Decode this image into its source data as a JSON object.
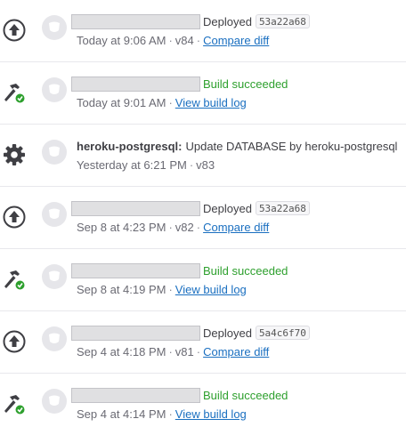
{
  "activity": [
    {
      "type": "deploy",
      "status_label": "Deployed",
      "commit": "53a22a68",
      "time": "Today at 9:06 AM",
      "version": "v84",
      "link_label": "Compare diff"
    },
    {
      "type": "build",
      "status_label": "Build succeeded",
      "time": "Today at 9:01 AM",
      "link_label": "View build log"
    },
    {
      "type": "addon",
      "addon_name": "heroku-postgresql:",
      "message": "Update DATABASE by heroku-postgresql",
      "time": "Yesterday at 6:21 PM",
      "version": "v83"
    },
    {
      "type": "deploy",
      "status_label": "Deployed",
      "commit": "53a22a68",
      "time": "Sep 8 at 4:23 PM",
      "version": "v82",
      "link_label": "Compare diff"
    },
    {
      "type": "build",
      "status_label": "Build succeeded",
      "time": "Sep 8 at 4:19 PM",
      "link_label": "View build log"
    },
    {
      "type": "deploy",
      "status_label": "Deployed",
      "commit": "5a4c6f70",
      "time": "Sep 4 at 4:18 PM",
      "version": "v81",
      "link_label": "Compare diff"
    },
    {
      "type": "build",
      "status_label": "Build succeeded",
      "time": "Sep 4 at 4:14 PM",
      "link_label": "View build log"
    }
  ],
  "separator": "·",
  "colors": {
    "success": "#2ea02e",
    "link": "#1a6fc0",
    "icon": "#3f3f44"
  }
}
